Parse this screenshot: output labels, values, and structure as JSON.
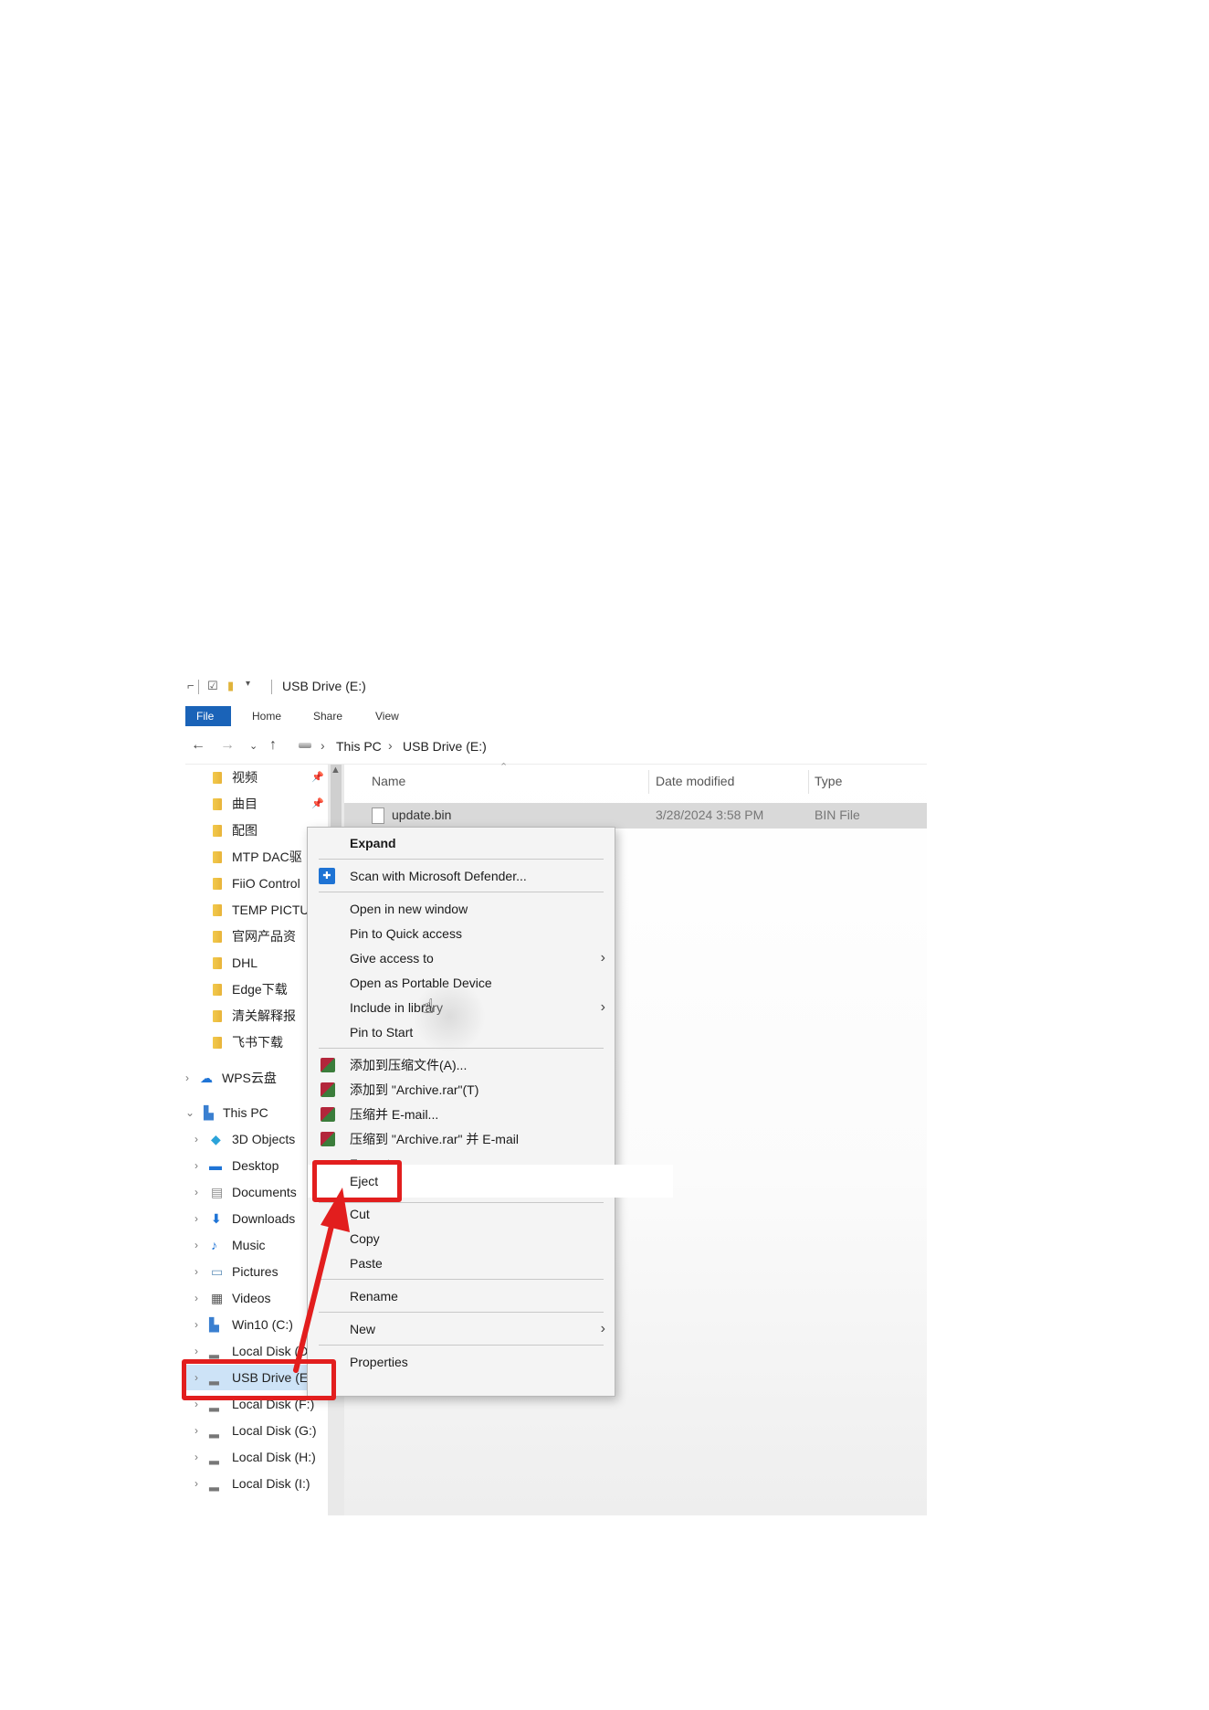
{
  "window": {
    "title": "USB Drive (E:)"
  },
  "ribbon": {
    "tabs": [
      "File",
      "Home",
      "Share",
      "View"
    ]
  },
  "address": {
    "path": [
      "This PC",
      "USB Drive (E:)"
    ]
  },
  "navpane": {
    "quick_access": [
      "视频",
      "曲目",
      "配图",
      "MTP DAC驱",
      "FiiO Control",
      "TEMP PICTU",
      "官网产品资",
      "DHL",
      "Edge下载",
      "清关解释报",
      "飞书下载"
    ],
    "wps": "WPS云盘",
    "this_pc": "This PC",
    "this_pc_items": [
      "3D Objects",
      "Desktop",
      "Documents",
      "Downloads",
      "Music",
      "Pictures",
      "Videos",
      "Win10 (C:)",
      "Local Disk (D",
      "USB Drive (E:)",
      "Local Disk (F:)",
      "Local Disk (G:)",
      "Local Disk (H:)",
      "Local Disk (I:)"
    ]
  },
  "columns": {
    "name": "Name",
    "date": "Date modified",
    "type": "Type"
  },
  "file": {
    "name": "update.bin",
    "date": "3/28/2024 3:58 PM",
    "type": "BIN File"
  },
  "context_menu": {
    "expand": "Expand",
    "defender": "Scan with Microsoft Defender...",
    "open_new_window": "Open in new window",
    "pin_quick": "Pin to Quick access",
    "give_access": "Give access to",
    "open_portable": "Open as Portable Device",
    "include_library": "Include in library",
    "pin_start": "Pin to Start",
    "rar_add": "添加到压缩文件(A)...",
    "rar_add_archive": "添加到 \"Archive.rar\"(T)",
    "rar_email": "压缩并 E-mail...",
    "rar_archive_email": "压缩到 \"Archive.rar\" 并 E-mail",
    "format": "Format...",
    "eject": "Eject",
    "cut": "Cut",
    "copy": "Copy",
    "paste": "Paste",
    "rename": "Rename",
    "new": "New",
    "properties": "Properties"
  },
  "colors": {
    "file_tab": "#1a63b8",
    "annotation": "#e21e1e"
  }
}
